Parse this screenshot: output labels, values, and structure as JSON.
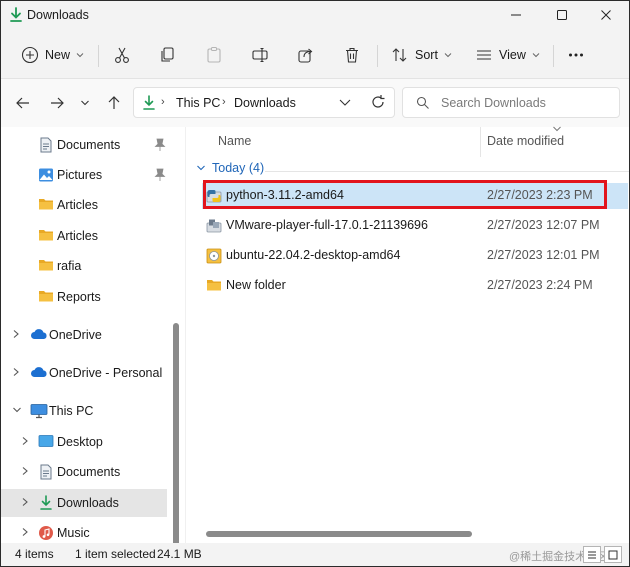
{
  "window": {
    "title": "Downloads"
  },
  "toolbar": {
    "new_label": "New",
    "sort_label": "Sort",
    "view_label": "View"
  },
  "address": {
    "crumbs": [
      "This PC",
      "Downloads"
    ],
    "search_placeholder": "Search Downloads"
  },
  "sidebar": {
    "items": [
      {
        "label": "Documents",
        "icon": "document-icon",
        "pinned": true
      },
      {
        "label": "Pictures",
        "icon": "pictures-icon",
        "pinned": true
      },
      {
        "label": "Articles",
        "icon": "folder-icon"
      },
      {
        "label": "Articles",
        "icon": "folder-icon"
      },
      {
        "label": "rafia",
        "icon": "folder-icon"
      },
      {
        "label": "Reports",
        "icon": "folder-icon"
      },
      {
        "label": "OneDrive",
        "icon": "cloud-icon"
      },
      {
        "label": "OneDrive - Personal",
        "icon": "cloud-icon"
      },
      {
        "label": "This PC",
        "icon": "computer-icon",
        "expanded": true
      },
      {
        "label": "Desktop",
        "icon": "desktop-icon"
      },
      {
        "label": "Documents",
        "icon": "document-icon"
      },
      {
        "label": "Downloads",
        "icon": "downloads-icon",
        "selected": true
      },
      {
        "label": "Music",
        "icon": "music-icon"
      }
    ]
  },
  "columns": {
    "name": "Name",
    "date": "Date modified"
  },
  "group": {
    "label": "Today (4)"
  },
  "files": [
    {
      "name": "python-3.11.2-amd64",
      "date": "2/27/2023 2:23 PM",
      "icon": "python-installer-icon",
      "selected": true
    },
    {
      "name": "VMware-player-full-17.0.1-21139696",
      "date": "2/27/2023 12:07 PM",
      "icon": "vmware-installer-icon"
    },
    {
      "name": "ubuntu-22.04.2-desktop-amd64",
      "date": "2/27/2023 12:01 PM",
      "icon": "disc-image-icon"
    },
    {
      "name": "New folder",
      "date": "2/27/2023 2:24 PM",
      "icon": "folder-icon"
    }
  ],
  "status": {
    "items": "4 items",
    "selected": "1 item selected",
    "size": "24.1 MB"
  },
  "watermark": "@稀土掘金技术社区",
  "colors": {
    "accent": "#2066b8",
    "selection": "#cce4f7",
    "highlight": "#e2141c",
    "folder": "#f5c041"
  }
}
